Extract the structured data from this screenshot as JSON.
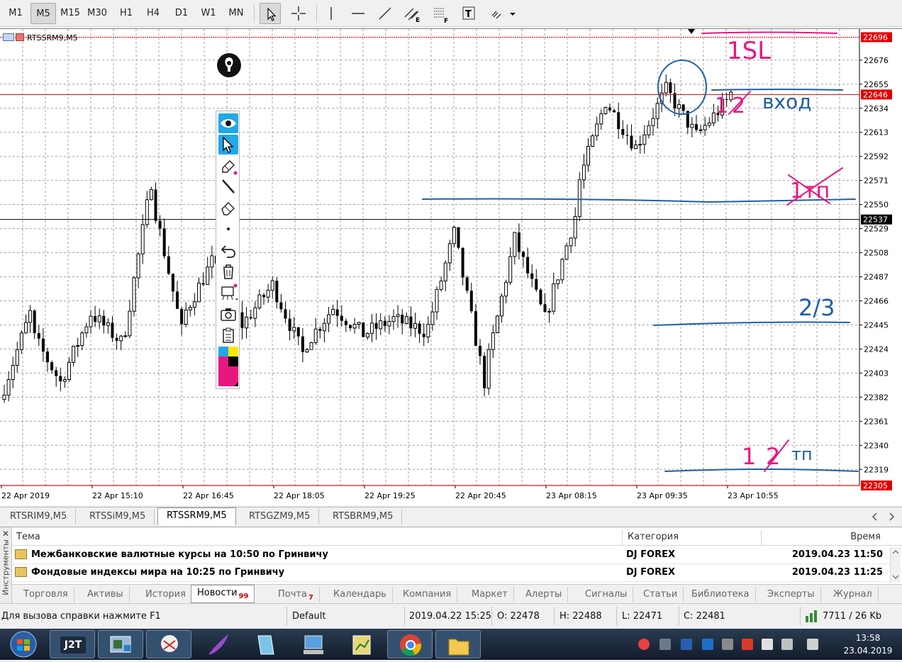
{
  "toolbar": {
    "timeframes": [
      {
        "label": "M1",
        "active": false
      },
      {
        "label": "M5",
        "active": true
      },
      {
        "label": "M15",
        "active": false
      },
      {
        "label": "M30",
        "active": false
      },
      {
        "label": "H1",
        "active": false
      },
      {
        "label": "H4",
        "active": false
      },
      {
        "label": "D1",
        "active": false
      },
      {
        "label": "W1",
        "active": false
      },
      {
        "label": "MN",
        "active": false
      }
    ]
  },
  "chart": {
    "symbol": "RTSSRM9,M5",
    "price_labels": [
      "22676",
      "22655",
      "22634",
      "22613",
      "22592",
      "22571",
      "22550",
      "22529",
      "22508",
      "22487",
      "22466",
      "22445",
      "22424",
      "22403",
      "22382",
      "22361",
      "22340",
      "22319"
    ],
    "marked_prices": {
      "top_red": "22696",
      "red_line": "22646",
      "current": "22537",
      "bottom_red": "22305"
    },
    "time_labels": [
      "22 Apr 2019",
      "22 Apr 15:10",
      "22 Apr 16:45",
      "22 Apr 18:05",
      "22 Apr 19:25",
      "22 Apr 20:45",
      "23 Apr 08:15",
      "23 Apr 09:35",
      "23 Apr 10:55"
    ],
    "annotations": {
      "sl": "1SL",
      "entry_qty": "1",
      "entry_crossed": "2",
      "entry_word": "вход",
      "tp_mid": "1тп",
      "two_thirds": "2/3",
      "tp_bottom_qty": "1",
      "tp_bottom_crossed": "2",
      "tp_bottom_word": "тп"
    },
    "colors": {
      "bull": "#000000",
      "bear": "#000000",
      "grid": "#a0a0a0",
      "pen_pink": "#e8177e",
      "pen_blue": "#1f5fa8",
      "red_line": "#e00000"
    }
  },
  "chart_data": {
    "type": "candlestick",
    "ylim": [
      22300,
      22700
    ],
    "y_ticks": [
      22319,
      22340,
      22361,
      22382,
      22403,
      22424,
      22445,
      22466,
      22487,
      22508,
      22529,
      22550,
      22571,
      22592,
      22613,
      22634,
      22655,
      22676
    ],
    "x_tick_labels": [
      "22 Apr 2019",
      "22 Apr 15:10",
      "22 Apr 16:45",
      "22 Apr 18:05",
      "22 Apr 19:25",
      "22 Apr 20:45",
      "23 Apr 08:15",
      "23 Apr 09:35",
      "23 Apr 10:55"
    ],
    "horizontal_lines": [
      22696,
      22646,
      22537,
      22305
    ],
    "segments": [
      [
        22380,
        22455
      ],
      [
        22440,
        22395
      ],
      [
        22395,
        22455
      ],
      [
        22455,
        22430
      ],
      [
        22420,
        22570
      ],
      [
        22560,
        22440
      ],
      [
        22450,
        22500
      ],
      [
        22500,
        22445
      ],
      [
        22445,
        22480
      ],
      [
        22480,
        22420
      ],
      [
        22425,
        22460
      ],
      [
        22460,
        22437
      ],
      [
        22437,
        22450
      ],
      [
        22450,
        22440
      ],
      [
        22430,
        22525
      ],
      [
        22525,
        22395
      ],
      [
        22400,
        22520
      ],
      [
        22520,
        22450
      ],
      [
        22450,
        22540
      ],
      [
        22560,
        22640
      ],
      [
        22640,
        22600
      ],
      [
        22600,
        22650
      ],
      [
        22650,
        22610
      ],
      [
        22610,
        22640
      ],
      [
        22640,
        22690
      ],
      [
        22670,
        22550
      ],
      [
        22553,
        22535
      ]
    ]
  },
  "tabs": {
    "items": [
      {
        "label": "RTSRIM9,M5",
        "active": false
      },
      {
        "label": "RTSSiM9,M5",
        "active": false
      },
      {
        "label": "RTSSRM9,M5",
        "active": true
      },
      {
        "label": "RTSGZM9,M5",
        "active": false
      },
      {
        "label": "RTSBRM9,M5",
        "active": false
      }
    ]
  },
  "terminal": {
    "side_label": "Инструменты",
    "columns": {
      "topic": "Тема",
      "category": "Категория",
      "time": "Время"
    },
    "rows": [
      {
        "topic": "Межбанковские валютные курсы на 10:50 по Гринвичу",
        "category": "DJ FOREX",
        "time": "2019.04.23 11:50"
      },
      {
        "topic": "Фондовые индексы мира на 10:25 по Гринвичу",
        "category": "DJ FOREX",
        "time": "2019.04.23 11:25"
      }
    ],
    "tabs": [
      {
        "label": "Торговля",
        "badge": ""
      },
      {
        "label": "Активы",
        "badge": ""
      },
      {
        "label": "История",
        "badge": ""
      },
      {
        "label": "Новости",
        "badge": "99",
        "active": true
      },
      {
        "label": "Почта",
        "badge": "7"
      },
      {
        "label": "Календарь",
        "badge": ""
      },
      {
        "label": "Компания",
        "badge": ""
      },
      {
        "label": "Маркет",
        "badge": ""
      },
      {
        "label": "Алерты",
        "badge": ""
      },
      {
        "label": "Сигналы",
        "badge": ""
      },
      {
        "label": "Статьи",
        "badge": ""
      },
      {
        "label": "Библиотека",
        "badge": ""
      },
      {
        "label": "Эксперты",
        "badge": ""
      },
      {
        "label": "Журнал",
        "badge": ""
      }
    ]
  },
  "status": {
    "help": "Для вызова справки нажмите F1",
    "profile": "Default",
    "datetime": "2019.04.22 15:25",
    "open": "O: 22478",
    "high": "H: 22488",
    "low": "L: 22471",
    "close": "C: 22481",
    "traffic": "7711 / 26 Kb"
  },
  "taskbar": {
    "j2t_label": "J2T",
    "time": "13:58",
    "date": "23.04.2019"
  }
}
